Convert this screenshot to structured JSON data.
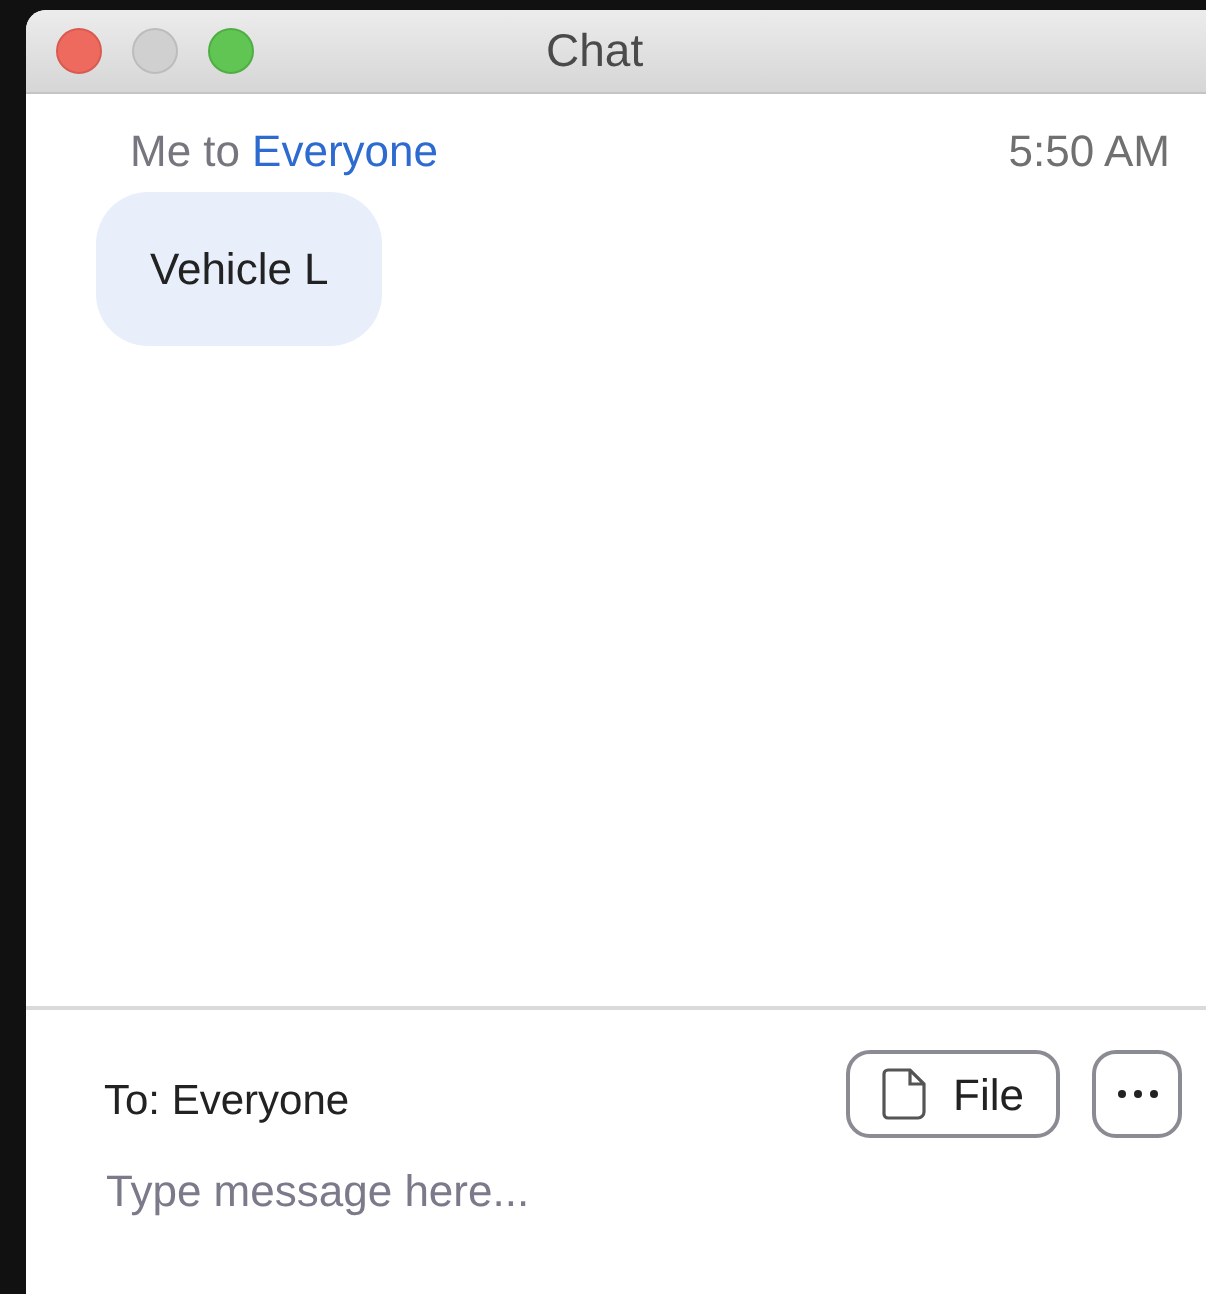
{
  "window": {
    "title": "Chat"
  },
  "messages": [
    {
      "sender": "Me to",
      "recipient": "Everyone",
      "time": "5:50 AM",
      "text": "Vehicle L"
    }
  ],
  "composer": {
    "to_label": "To: Everyone",
    "file_button": "File",
    "placeholder": "Type message here..."
  }
}
